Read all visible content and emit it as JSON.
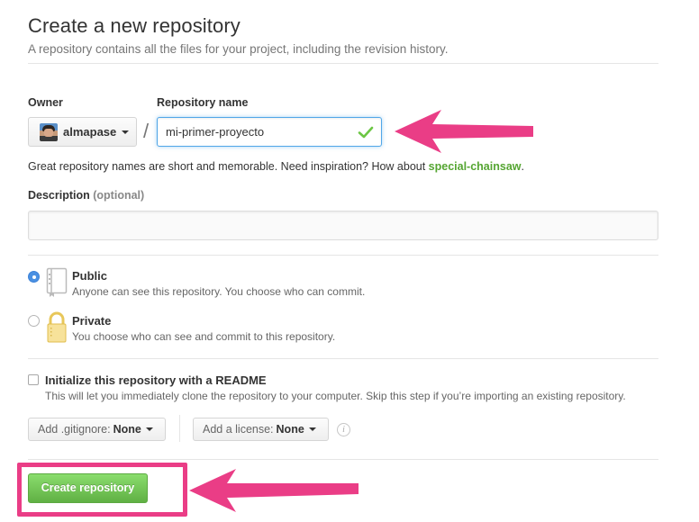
{
  "header": {
    "title": "Create a new repository",
    "subtitle": "A repository contains all the files for your project, including the revision history."
  },
  "form": {
    "owner_label": "Owner",
    "owner_name": "almapase",
    "separator": "/",
    "repo_name_label": "Repository name",
    "repo_name_value": "mi-primer-proyecto",
    "hint_prefix": "Great repository names are short and memorable. Need inspiration? How about ",
    "hint_suggestion": "special-chainsaw",
    "hint_suffix": ".",
    "description_label": "Description",
    "description_optional": "(optional)",
    "description_value": ""
  },
  "visibility": {
    "selected": "public",
    "public_title": "Public",
    "public_desc": "Anyone can see this repository. You choose who can commit.",
    "private_title": "Private",
    "private_desc": "You choose who can see and commit to this repository."
  },
  "init": {
    "checked": false,
    "title": "Initialize this repository with a README",
    "desc": "This will let you immediately clone the repository to your computer. Skip this step if you’re importing an existing repository."
  },
  "options": {
    "gitignore_prefix": "Add .gitignore:",
    "gitignore_value": "None",
    "license_prefix": "Add a license:",
    "license_value": "None",
    "info_glyph": "i"
  },
  "submit": {
    "label": "Create repository"
  },
  "icons": {
    "repo_valid": "check-icon",
    "public": "repo-book-icon",
    "private": "lock-icon",
    "annotations": "pink-arrow-icon"
  },
  "colors": {
    "annotation": "#ea3d86",
    "primary_button": "#60b044",
    "suggestion": "#55a532",
    "focus": "#51a7e8",
    "radio_checked": "#4a90e2"
  }
}
